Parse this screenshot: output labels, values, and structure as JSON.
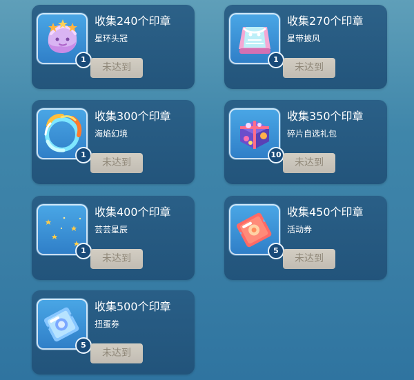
{
  "rewards": [
    {
      "title": "收集240个印章",
      "item_name": "星环头冠",
      "count": "1",
      "status": "未达到",
      "icon": "star-crown-icon"
    },
    {
      "title": "收集270个印章",
      "item_name": "星带披风",
      "count": "1",
      "status": "未达到",
      "icon": "cape-icon"
    },
    {
      "title": "收集300个印章",
      "item_name": "海焰幻境",
      "count": "1",
      "status": "未达到",
      "icon": "fire-ring-icon"
    },
    {
      "title": "收集350个印章",
      "item_name": "碎片自选礼包",
      "count": "10",
      "status": "未达到",
      "icon": "gift-box-icon"
    },
    {
      "title": "收集400个印章",
      "item_name": "芸芸星辰",
      "count": "1",
      "status": "未达到",
      "icon": "star-sky-icon"
    },
    {
      "title": "收集450个印章",
      "item_name": "活动券",
      "count": "5",
      "status": "未达到",
      "icon": "activity-ticket-icon"
    },
    {
      "title": "收集500个印章",
      "item_name": "扭蛋券",
      "count": "5",
      "status": "未达到",
      "icon": "gacha-ticket-icon"
    }
  ]
}
